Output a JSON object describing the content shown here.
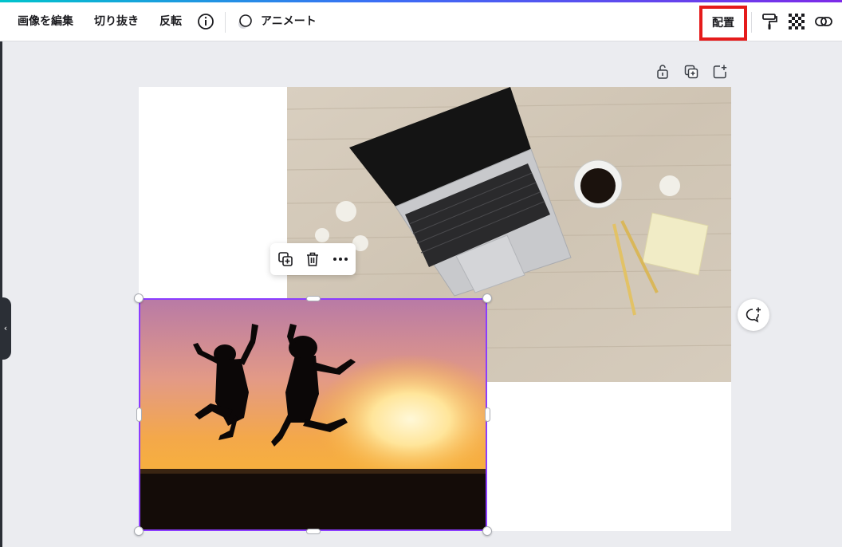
{
  "toolbar": {
    "edit_image": "画像を編集",
    "crop": "切り抜き",
    "flip": "反転",
    "animate": "アニメート",
    "position": "配置"
  },
  "icons": {
    "info": "info-icon",
    "animate": "animate-icon",
    "paint_format": "paint-roller-icon",
    "transparency": "transparency-icon",
    "link": "link-icon",
    "lock": "lock-icon",
    "duplicate_page": "duplicate-page-icon",
    "add_page": "add-page-icon",
    "copy": "copy-icon",
    "trash": "trash-icon",
    "more": "more-icon",
    "comment": "comment-add-icon",
    "collapse": "chevron-left-icon"
  },
  "colors": {
    "selection": "#8b3dff",
    "highlight": "#e51b1b",
    "canvas_bg": "#ebecf0"
  }
}
